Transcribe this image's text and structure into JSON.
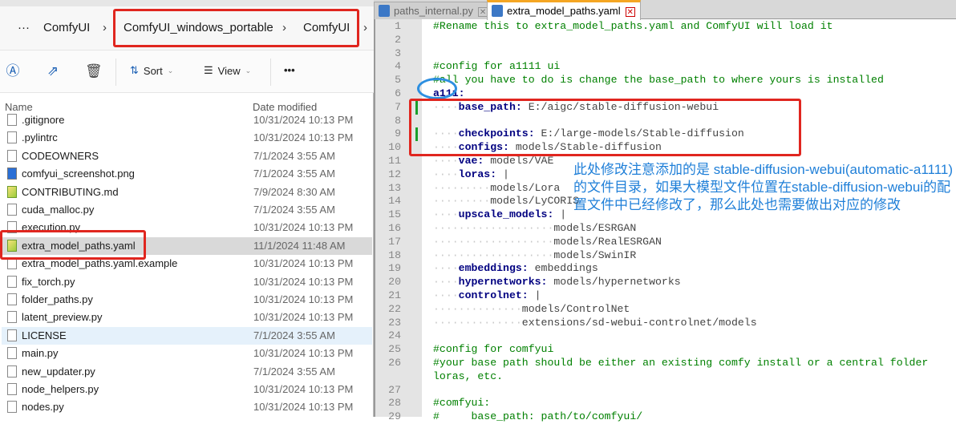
{
  "explorer": {
    "breadcrumb": {
      "more": "···",
      "items": [
        "ComfyUI",
        "ComfyUI_windows_portable",
        "ComfyUI"
      ],
      "separator": "›"
    },
    "toolbar": {
      "sort_label": "Sort",
      "view_label": "View",
      "more": "•••"
    },
    "columns": {
      "name": "Name",
      "date": "Date modified"
    },
    "files": [
      {
        "name": ".gitignore",
        "date": "10/31/2024 10:13 PM",
        "icon": "file"
      },
      {
        "name": ".pylintrc",
        "date": "10/31/2024 10:13 PM",
        "icon": "file"
      },
      {
        "name": "CODEOWNERS",
        "date": "7/1/2024 3:55 AM",
        "icon": "file"
      },
      {
        "name": "comfyui_screenshot.png",
        "date": "7/1/2024 3:55 AM",
        "icon": "img"
      },
      {
        "name": "CONTRIBUTING.md",
        "date": "7/9/2024 8:30 AM",
        "icon": "note"
      },
      {
        "name": "cuda_malloc.py",
        "date": "7/1/2024 3:55 AM",
        "icon": "file"
      },
      {
        "name": "execution.py",
        "date": "10/31/2024 10:13 PM",
        "icon": "file"
      },
      {
        "name": "extra_model_paths.yaml",
        "date": "11/1/2024 11:48 AM",
        "icon": "note",
        "state": "sel"
      },
      {
        "name": "extra_model_paths.yaml.example",
        "date": "10/31/2024 10:13 PM",
        "icon": "file"
      },
      {
        "name": "fix_torch.py",
        "date": "10/31/2024 10:13 PM",
        "icon": "file"
      },
      {
        "name": "folder_paths.py",
        "date": "10/31/2024 10:13 PM",
        "icon": "file"
      },
      {
        "name": "latent_preview.py",
        "date": "10/31/2024 10:13 PM",
        "icon": "file"
      },
      {
        "name": "LICENSE",
        "date": "7/1/2024 3:55 AM",
        "icon": "file",
        "state": "hov"
      },
      {
        "name": "main.py",
        "date": "10/31/2024 10:13 PM",
        "icon": "file"
      },
      {
        "name": "new_updater.py",
        "date": "7/1/2024 3:55 AM",
        "icon": "file"
      },
      {
        "name": "node_helpers.py",
        "date": "10/31/2024 10:13 PM",
        "icon": "file"
      },
      {
        "name": "nodes.py",
        "date": "10/31/2024 10:13 PM",
        "icon": "file"
      }
    ]
  },
  "editor": {
    "tabs": [
      {
        "label": "paths_internal.py",
        "active": false
      },
      {
        "label": "extra_model_paths.yaml",
        "active": true
      }
    ],
    "close_glyph": "✕",
    "lines": [
      {
        "n": "1",
        "c": "#Rename this to extra_model_paths.yaml and ComfyUI will load it"
      },
      {
        "n": "2"
      },
      {
        "n": "3"
      },
      {
        "n": "4",
        "c": "#config for a1111 ui"
      },
      {
        "n": "5",
        "c": "#all you have to do is change the base_path to where yours is installed"
      },
      {
        "n": "6",
        "k": "a111:"
      },
      {
        "n": "7",
        "i": 4,
        "k": "base_path:",
        "v": " E:/aigc/stable-diffusion-webui",
        "chg": true
      },
      {
        "n": "8"
      },
      {
        "n": "9",
        "i": 4,
        "k": "checkpoints:",
        "v": " E:/large-models/Stable-diffusion",
        "chg": true
      },
      {
        "n": "10",
        "i": 4,
        "k": "configs:",
        "v": " models/Stable-diffusion"
      },
      {
        "n": "11",
        "i": 4,
        "k": "vae:",
        "v": " models/VAE"
      },
      {
        "n": "12",
        "i": 4,
        "k": "loras:",
        "v": " |"
      },
      {
        "n": "13",
        "i": 9,
        "v": "models/Lora"
      },
      {
        "n": "14",
        "i": 9,
        "v": "models/LyCORIS"
      },
      {
        "n": "15",
        "i": 4,
        "k": "upscale_models:",
        "v": " |"
      },
      {
        "n": "16",
        "i": 19,
        "v": "models/ESRGAN"
      },
      {
        "n": "17",
        "i": 19,
        "v": "models/RealESRGAN"
      },
      {
        "n": "18",
        "i": 19,
        "v": "models/SwinIR"
      },
      {
        "n": "19",
        "i": 4,
        "k": "embeddings:",
        "v": " embeddings"
      },
      {
        "n": "20",
        "i": 4,
        "k": "hypernetworks:",
        "v": " models/hypernetworks"
      },
      {
        "n": "21",
        "i": 4,
        "k": "controlnet:",
        "v": " |"
      },
      {
        "n": "22",
        "i": 14,
        "v": "models/ControlNet"
      },
      {
        "n": "23",
        "i": 14,
        "v": "extensions/sd-webui-controlnet/models"
      },
      {
        "n": "24"
      },
      {
        "n": "25",
        "c": "#config for comfyui"
      },
      {
        "n": "26",
        "c": "#your base path should be either an existing comfy install or a central folder"
      },
      {
        "n": "",
        "c": "loras, etc."
      },
      {
        "n": "27"
      },
      {
        "n": "28",
        "c": "#comfyui:"
      },
      {
        "n": "29",
        "c": "#     base_path: path/to/comfyui/"
      }
    ]
  },
  "annotation": {
    "text": "此处修改注意添加的是 stable-diffusion-webui(automatic-a1111)的文件目录，如果大模型文件位置在stable-diffusion-webui的配置文件中已经修改了，那么此处也需要做出对应的修改"
  },
  "colors": {
    "highlight_box": "#e0261f",
    "ellipse": "#2d8fe0",
    "note_text": "#1f7fd8"
  }
}
